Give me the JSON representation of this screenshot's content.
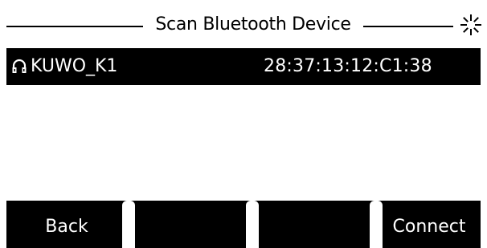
{
  "title": "Scan Bluetooth Device",
  "scan_indicator_icon": "loading-spinner-icon",
  "devices": [
    {
      "icon": "headset-icon",
      "name": "KUWO_K1",
      "mac": "28:37:13:12:C1:38",
      "selected": true
    }
  ],
  "softkeys": [
    {
      "label": "Back"
    },
    {
      "label": ""
    },
    {
      "label": ""
    },
    {
      "label": "Connect"
    }
  ],
  "colors": {
    "background": "#ffffff",
    "selection": "#000000",
    "text": "#000000",
    "selected_text": "#ffffff"
  }
}
